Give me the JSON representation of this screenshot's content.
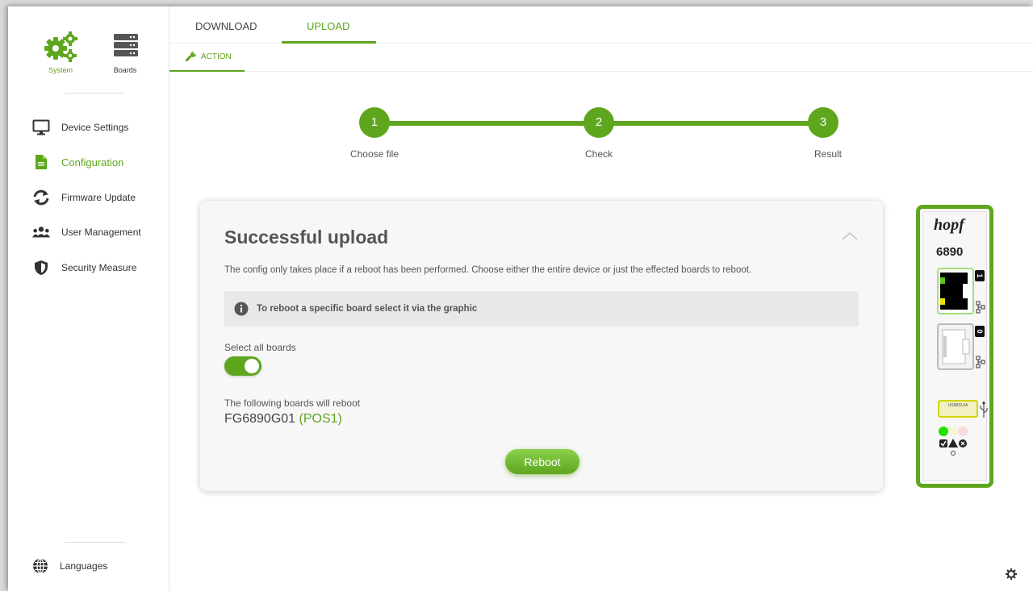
{
  "sidebar": {
    "top": [
      {
        "label": "System",
        "icon": "gears-icon"
      },
      {
        "label": "Boards",
        "icon": "server-rack-icon"
      }
    ],
    "items": [
      {
        "label": "Device Settings",
        "icon": "monitor-icon"
      },
      {
        "label": "Configuration",
        "icon": "document-icon",
        "active": true
      },
      {
        "label": "Firmware Update",
        "icon": "refresh-icon"
      },
      {
        "label": "User Management",
        "icon": "users-icon"
      },
      {
        "label": "Security Measure",
        "icon": "shield-icon"
      }
    ],
    "languages": "Languages"
  },
  "tabs": {
    "download": "DOWNLOAD",
    "upload": "UPLOAD",
    "active": "UPLOAD"
  },
  "subtab": {
    "label": "ACTION",
    "icon": "wrench-icon"
  },
  "stepper": {
    "steps": [
      {
        "num": "1",
        "label": "Choose file"
      },
      {
        "num": "2",
        "label": "Check"
      },
      {
        "num": "3",
        "label": "Result"
      }
    ]
  },
  "card": {
    "title": "Successful upload",
    "description": "The config only takes place if a reboot has been performed. Choose either the entire device or just the effected boards to reboot.",
    "info": "To reboot a specific board select it via the graphic",
    "select_all_label": "Select all boards",
    "select_all_on": true,
    "follow_label": "The following boards will reboot",
    "board_name": "FG6890G01",
    "board_pos": "(POS1)",
    "reboot_label": "Reboot"
  },
  "device": {
    "brand": "hopf",
    "model": "6890",
    "port_top": "1",
    "port_bottom": "0",
    "usb_label": "USB8SUIA"
  },
  "colors": {
    "accent": "#5ea61e",
    "accent_light": "#8bd14b"
  }
}
